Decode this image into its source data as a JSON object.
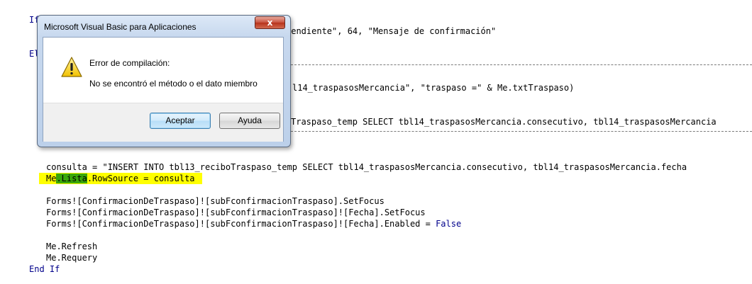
{
  "editor": {
    "lines": {
      "l1_prefix": "If",
      "l1_visible_tail": "pendiente\", 64, \"Mensaje de confirmación\"",
      "l2_prefix": "El",
      "l3_visible_tail": "l14_traspasosMercancia\", \"traspaso =\" & Me.txtTraspaso)",
      "l4_visible_tail": "Traspaso_temp SELECT tbl14_traspasosMercancia.consecutivo, tbl14_traspasosMercancia",
      "consulta_line": "consulta = \"INSERT INTO tbl13_reciboTraspaso_temp SELECT tbl14_traspasosMercancia.consecutivo, tbl14_traspasosMercancia.fecha",
      "me_prefix": "Me",
      "lista_hl": ".Lista",
      "rowsource_tail": ".RowSource = consulta",
      "forms1": "Forms![ConfirmacionDeTraspaso]![subFconfirmacionTraspaso].SetFocus",
      "forms2": "Forms![ConfirmacionDeTraspaso]![subFconfirmacionTraspaso]![Fecha].SetFocus",
      "forms3_prefix": "Forms![ConfirmacionDeTraspaso]![subFconfirmacionTraspaso]![Fecha].Enabled = ",
      "forms3_kw": "False",
      "refresh": "Me.Refresh",
      "requery": "Me.Requery",
      "end_if": "End If"
    }
  },
  "dialog": {
    "title": "Microsoft Visual Basic para Aplicaciones",
    "close_glyph": "x",
    "icon": "warning-icon",
    "message_heading": "Error de compilación:",
    "message_body": "No se encontró el método o el dato miembro",
    "ok_label": "Aceptar",
    "help_label": "Ayuda"
  },
  "colors": {
    "keyword": "#00008b",
    "highlight_yellow": "#ffff00",
    "highlight_green": "#3aa70a"
  }
}
